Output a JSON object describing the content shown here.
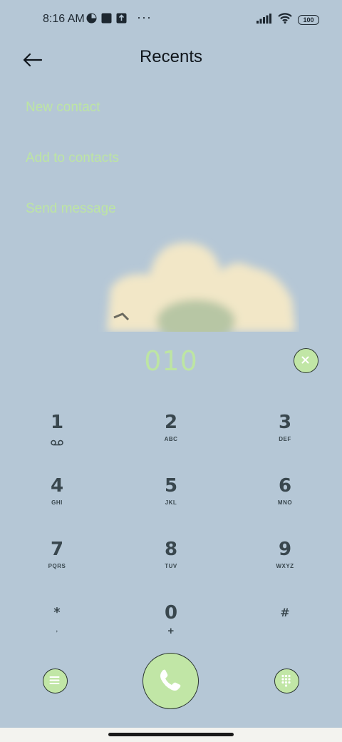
{
  "status_bar": {
    "time": "8:16 AM",
    "battery": "100",
    "more": "···"
  },
  "header": {
    "title": "Recents"
  },
  "options": [
    {
      "label": "New contact"
    },
    {
      "label": "Add to contacts"
    },
    {
      "label": "Send message"
    }
  ],
  "dialer": {
    "number": "010"
  },
  "keypad": [
    {
      "digit": "1",
      "letters": ""
    },
    {
      "digit": "2",
      "letters": "ABC"
    },
    {
      "digit": "3",
      "letters": "DEF"
    },
    {
      "digit": "4",
      "letters": "GHI"
    },
    {
      "digit": "5",
      "letters": "JKL"
    },
    {
      "digit": "6",
      "letters": "MNO"
    },
    {
      "digit": "7",
      "letters": "PQRS"
    },
    {
      "digit": "8",
      "letters": "TUV"
    },
    {
      "digit": "9",
      "letters": "WXYZ"
    },
    {
      "digit": "*",
      "letters": ","
    },
    {
      "digit": "0",
      "letters": "+"
    },
    {
      "digit": "#",
      "letters": ""
    }
  ],
  "icons": {
    "back": "arrow-left-icon",
    "clear": "close-icon",
    "voicemail": "voicemail-icon",
    "menu": "menu-icon",
    "call": "phone-icon",
    "dialpad": "dialpad-icon"
  },
  "colors": {
    "background": "#b5c7d6",
    "accent_green": "#c1e6a6",
    "option_text": "#bde5a3",
    "key_text": "#39474e"
  }
}
